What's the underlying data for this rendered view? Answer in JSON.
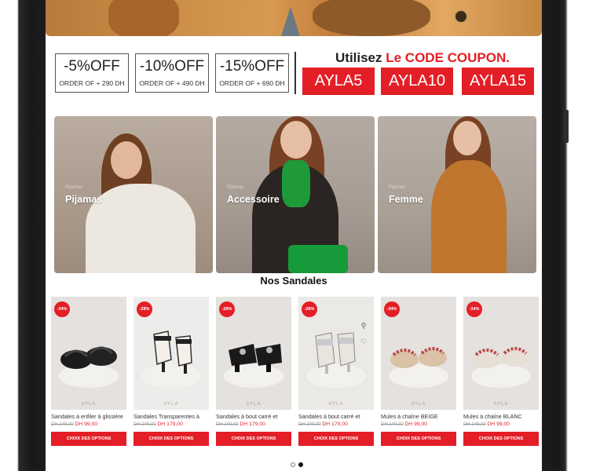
{
  "promo": {
    "offers": [
      {
        "discount": "-5%OFF",
        "condition": "ORDER OF + 290 DH"
      },
      {
        "discount": "-10%OFF",
        "condition": "ORDER OF + 490 DH"
      },
      {
        "discount": "-15%OFF",
        "condition": "ORDER OF + 690 DH"
      }
    ],
    "coupon_prefix": "Utilisez ",
    "coupon_highlight": "Le CODE COUPON.",
    "codes": [
      "AYLA5",
      "AYLA10",
      "AYLA15"
    ],
    "accent_color": "#e41e26"
  },
  "categories": [
    {
      "label": "Pijamas",
      "sub": "Pijamas"
    },
    {
      "label": "Accessoire",
      "sub": "Pijamas"
    },
    {
      "label": "Femme",
      "sub": "Pijamas"
    }
  ],
  "section_title": "Nos Sandales",
  "products": [
    {
      "badge": "-34%",
      "name": "Sandales à enfiler à glissière",
      "old_price": "DH 149,00",
      "new_price": "DH 99,00",
      "button": "CHOIX DES OPTIONS",
      "brand": "AYLA"
    },
    {
      "badge": "-28%",
      "name": "Sandales Transparentes à",
      "old_price": "DH 249,00",
      "new_price": "DH 179,00",
      "button": "CHOIX DES OPTIONS",
      "brand": "AYLA"
    },
    {
      "badge": "-28%",
      "name": "Sandales à bout carré et",
      "old_price": "DH 249,00",
      "new_price": "DH 179,00",
      "button": "CHOIX DES OPTIONS",
      "brand": "AYLA"
    },
    {
      "badge": "-28%",
      "name": "Sandales à bout carré et",
      "old_price": "DH 249,00",
      "new_price": "DH 179,00",
      "button": "CHOIX DES OPTIONS",
      "brand": "AYLA"
    },
    {
      "badge": "-34%",
      "name": "Mules à chaîne BEIGE",
      "old_price": "DH 149,00",
      "new_price": "DH 99,00",
      "button": "CHOIX DES OPTIONS",
      "brand": "AYLA"
    },
    {
      "badge": "-34%",
      "name": "Mules à chaîne BLANC",
      "old_price": "DH 149,00",
      "new_price": "DH 99,00",
      "button": "CHOIX DES OPTIONS",
      "brand": "AYLA"
    }
  ],
  "icons": {
    "quick_view": "search-icon",
    "wishlist": "heart-icon"
  },
  "carousel": {
    "page_count": 2,
    "active_page": 2
  }
}
